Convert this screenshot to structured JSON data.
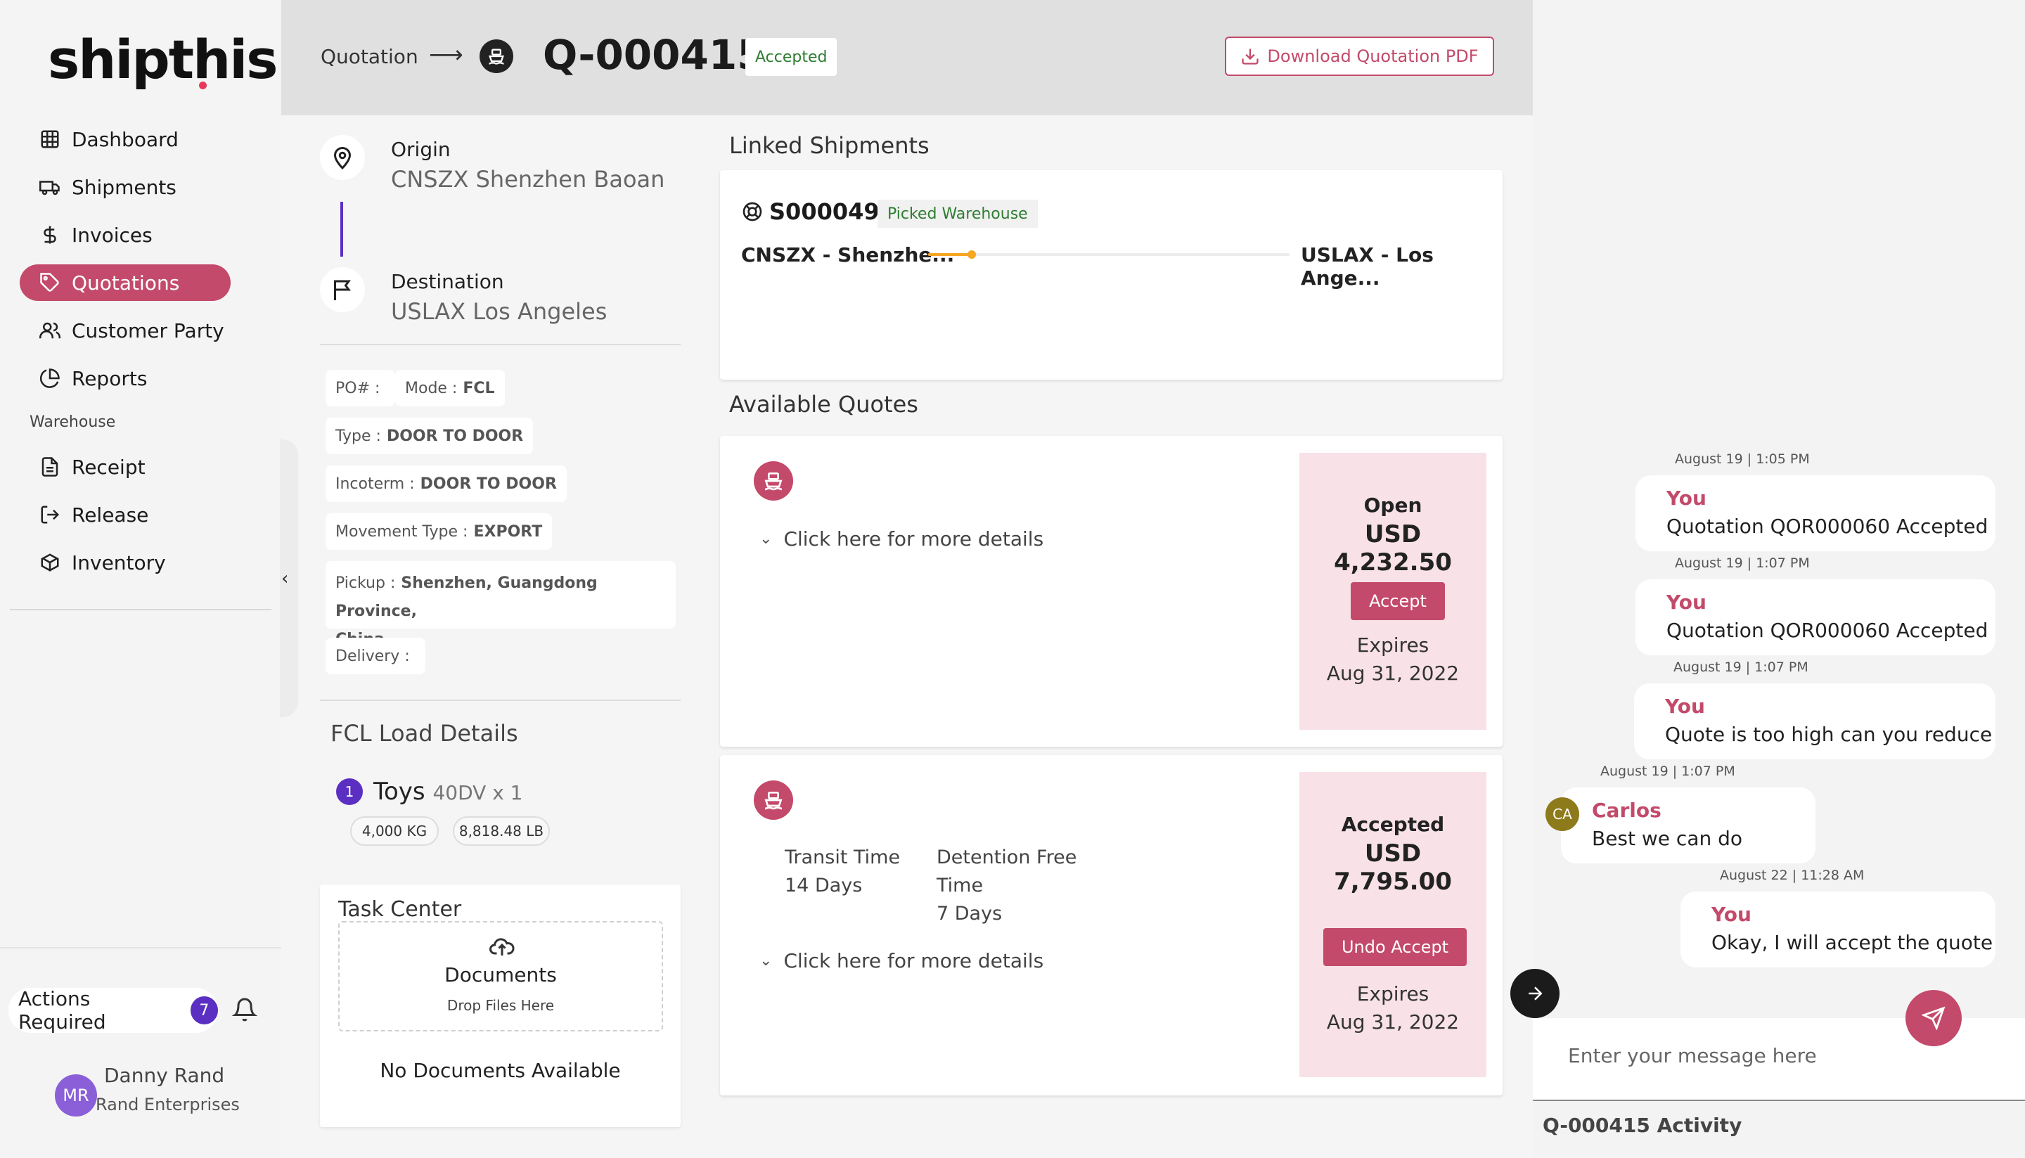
{
  "brand": {
    "logo_text": "shipthis"
  },
  "sidebar": {
    "items": [
      {
        "label": "Dashboard",
        "icon": "grid-icon"
      },
      {
        "label": "Shipments",
        "icon": "truck-icon"
      },
      {
        "label": "Invoices",
        "icon": "dollar-icon"
      },
      {
        "label": "Quotations",
        "icon": "tag-icon",
        "active": true
      },
      {
        "label": "Customer Party",
        "icon": "users-icon"
      },
      {
        "label": "Reports",
        "icon": "pie-chart-icon"
      }
    ],
    "section_label": "Warehouse",
    "warehouse_items": [
      {
        "label": "Receipt",
        "icon": "document-icon"
      },
      {
        "label": "Release",
        "icon": "logout-icon"
      },
      {
        "label": "Inventory",
        "icon": "box-icon"
      }
    ],
    "actions_label": "Actions Required",
    "actions_count": "7",
    "user": {
      "initials": "MR",
      "name": "Danny Rand",
      "company": "Rand Enterprises"
    }
  },
  "header": {
    "breadcrumb": "Quotation",
    "quote_number": "Q-000415",
    "status": "Accepted",
    "download_label": "Download Quotation PDF"
  },
  "route": {
    "origin_label": "Origin",
    "origin_value": "CNSZX Shenzhen Baoan",
    "destination_label": "Destination",
    "destination_value": "USLAX Los Angeles"
  },
  "attributes": {
    "po": {
      "label": "PO# :",
      "value": ""
    },
    "mode": {
      "label": "Mode :",
      "value": "FCL"
    },
    "type": {
      "label": "Type :",
      "value": "DOOR TO DOOR"
    },
    "incoterm": {
      "label": "Incoterm :",
      "value": "DOOR TO DOOR"
    },
    "movement": {
      "label": "Movement Type :",
      "value": "EXPORT"
    },
    "pickup": {
      "label": "Pickup :",
      "value": "Shenzhen, Guangdong Province,",
      "value2": "China"
    },
    "delivery": {
      "label": "Delivery :",
      "value": ""
    }
  },
  "fcl": {
    "title": "FCL Load Details",
    "index": "1",
    "commodity": "Toys",
    "container": "40DV x 1",
    "weight_kg": "4,000 KG",
    "weight_lb": "8,818.48 LB"
  },
  "task_center": {
    "title": "Task Center",
    "drop_title": "Documents",
    "drop_sub": "Drop Files Here",
    "empty": "No Documents Available"
  },
  "linked": {
    "title": "Linked Shipments",
    "shipment_id": "S000049",
    "shipment_status": "Picked Warehouse",
    "from": "CNSZX - Shenzhe...",
    "to": "USLAX - Los Ange...",
    "progress": 0.12
  },
  "quotes": {
    "title": "Available Quotes",
    "items": [
      {
        "details_label": "Click here for more details",
        "status": "Open",
        "currency": "USD",
        "amount": "4,232.50",
        "button": "Accept",
        "expires_label": "Expires",
        "expires_date": "Aug 31, 2022"
      },
      {
        "transit_label": "Transit Time",
        "transit_value": "14 Days",
        "detention_label1": "Detention Free",
        "detention_label2": "Time",
        "detention_value": "7 Days",
        "details_label": "Click here for more details",
        "status": "Accepted",
        "currency": "USD",
        "amount": "7,795.00",
        "button": "Undo Accept",
        "expires_label": "Expires",
        "expires_date": "Aug 31, 2022"
      }
    ]
  },
  "chat": {
    "messages": [
      {
        "time": "August 19 | 1:05 PM",
        "sender": "You",
        "text": "Quotation QOR000060 Accepted"
      },
      {
        "time": "August 19 | 1:07 PM",
        "sender": "You",
        "text": "Quotation QOR000060 Accepted"
      },
      {
        "time": "August 19 | 1:07 PM",
        "sender": "You",
        "text": "Quote is too high can you reduce"
      },
      {
        "time": "August 19 | 1:07 PM",
        "sender": "Carlos",
        "initials": "CA",
        "text": "Best we can do"
      },
      {
        "time": "August 22 | 11:28 AM",
        "sender": "You",
        "text": "Okay, I will accept the quote"
      }
    ],
    "input_placeholder": "Enter your message here",
    "activity_title": "Q-000415 Activity"
  },
  "colors": {
    "accent": "#c34a6a",
    "purple": "#5a2fc2",
    "success": "#2e7d32",
    "progress": "#f5a623"
  }
}
